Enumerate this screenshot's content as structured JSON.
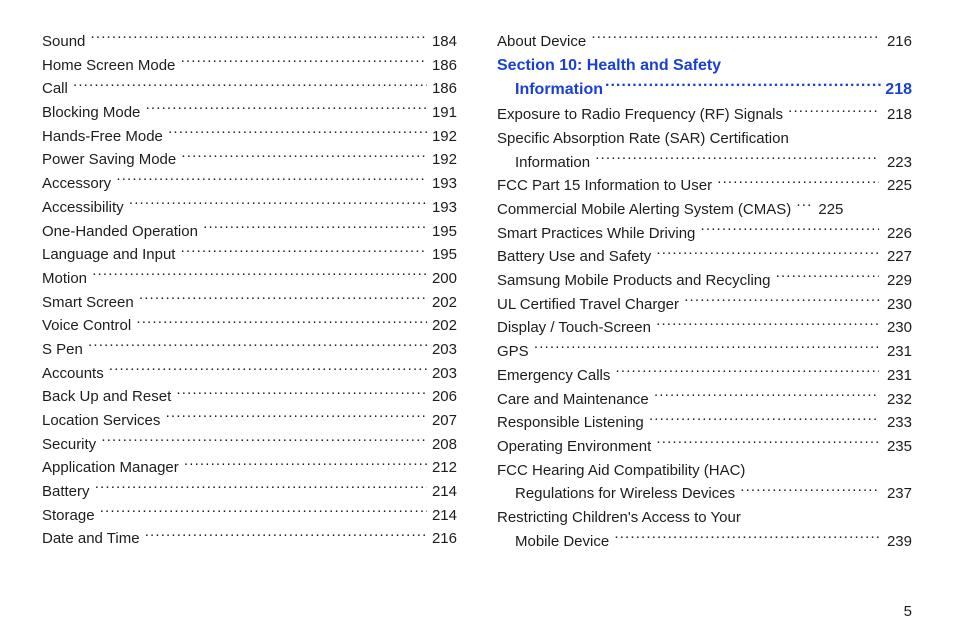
{
  "left_column": [
    {
      "label": "Sound",
      "page": "184"
    },
    {
      "label": "Home Screen Mode",
      "page": "186"
    },
    {
      "label": "Call",
      "page": "186"
    },
    {
      "label": "Blocking Mode",
      "page": "191"
    },
    {
      "label": "Hands-Free Mode",
      "page": "192"
    },
    {
      "label": "Power Saving Mode",
      "page": "192"
    },
    {
      "label": "Accessory",
      "page": "193"
    },
    {
      "label": "Accessibility",
      "page": "193"
    },
    {
      "label": "One-Handed Operation",
      "page": "195"
    },
    {
      "label": "Language and Input",
      "page": "195"
    },
    {
      "label": "Motion",
      "page": "200"
    },
    {
      "label": "Smart Screen",
      "page": "202"
    },
    {
      "label": "Voice Control",
      "page": "202"
    },
    {
      "label": "S Pen",
      "page": "203"
    },
    {
      "label": "Accounts",
      "page": "203"
    },
    {
      "label": "Back Up and Reset",
      "page": "206"
    },
    {
      "label": "Location Services",
      "page": "207"
    },
    {
      "label": "Security",
      "page": "208"
    },
    {
      "label": "Application Manager",
      "page": "212"
    },
    {
      "label": "Battery",
      "page": "214"
    },
    {
      "label": "Storage",
      "page": "214"
    },
    {
      "label": "Date and Time",
      "page": "216"
    }
  ],
  "right_column": {
    "pre_items": [
      {
        "label": "About Device",
        "page": "216",
        "indent": 0
      }
    ],
    "section": {
      "line1": "Section 10:  Health and Safety",
      "line2_label": "Information",
      "page": "218"
    },
    "items": [
      {
        "label": "Exposure to Radio Frequency (RF) Signals",
        "page": "218",
        "indent": 0
      },
      {
        "wrap_line": "Specific Absorption Rate (SAR) Certification",
        "indent": 0
      },
      {
        "label": "Information",
        "page": "223",
        "indent": 1
      },
      {
        "label": "FCC Part 15 Information to User",
        "page": "225",
        "indent": 0
      },
      {
        "label": "Commercial Mobile Alerting System (CMAS)",
        "page": "225",
        "indent": 0,
        "tight": true
      },
      {
        "label": "Smart Practices While Driving",
        "page": "226",
        "indent": 0
      },
      {
        "label": "Battery Use and Safety",
        "page": "227",
        "indent": 0
      },
      {
        "label": "Samsung Mobile Products and Recycling",
        "page": "229",
        "indent": 0
      },
      {
        "label": "UL Certified Travel Charger",
        "page": "230",
        "indent": 0
      },
      {
        "label": "Display / Touch-Screen",
        "page": "230",
        "indent": 0
      },
      {
        "label": "GPS",
        "page": "231",
        "indent": 0
      },
      {
        "label": "Emergency Calls",
        "page": "231",
        "indent": 0
      },
      {
        "label": "Care and Maintenance",
        "page": "232",
        "indent": 0
      },
      {
        "label": "Responsible Listening",
        "page": "233",
        "indent": 0
      },
      {
        "label": "Operating Environment",
        "page": "235",
        "indent": 0
      },
      {
        "wrap_line": "FCC Hearing Aid Compatibility (HAC)",
        "indent": 0
      },
      {
        "label": "Regulations for Wireless Devices",
        "page": "237",
        "indent": 1
      },
      {
        "wrap_line": "Restricting Children's Access to Your",
        "indent": 0
      },
      {
        "label": "Mobile Device",
        "page": "239",
        "indent": 1
      }
    ]
  },
  "page_number": "5"
}
